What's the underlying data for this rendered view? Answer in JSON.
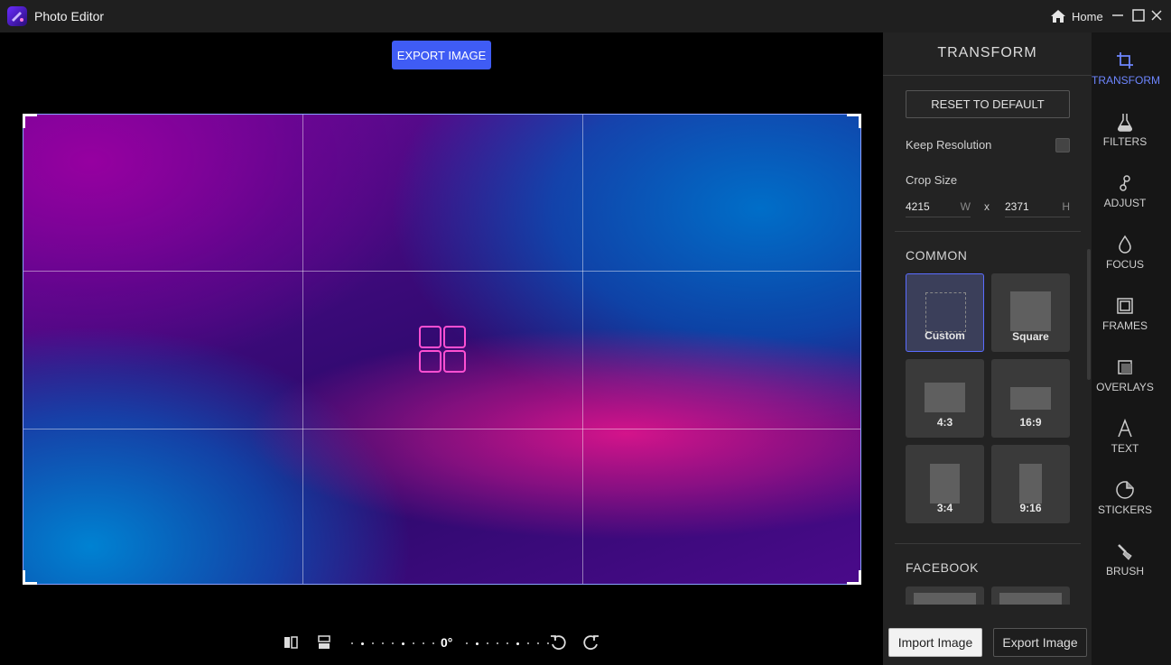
{
  "titlebar": {
    "app_title": "Photo Editor",
    "home_label": "Home"
  },
  "canvas": {
    "export_label": "EXPORT IMAGE",
    "rotation": "0°"
  },
  "panel": {
    "title": "TRANSFORM",
    "reset_label": "RESET TO DEFAULT",
    "keep_resolution_label": "Keep Resolution",
    "keep_resolution_checked": false,
    "crop_size_label": "Crop Size",
    "crop_w": "4215",
    "crop_w_unit": "W",
    "crop_x": "x",
    "crop_h": "2371",
    "crop_h_unit": "H",
    "common_title": "COMMON",
    "presets": [
      "Custom",
      "Square",
      "4:3",
      "16:9",
      "3:4",
      "9:16"
    ],
    "active_preset": "Custom",
    "facebook_title": "FACEBOOK",
    "import_label": "Import Image",
    "export_label": "Export Image"
  },
  "rail": {
    "items": [
      "TRANSFORM",
      "FILTERS",
      "ADJUST",
      "FOCUS",
      "FRAMES",
      "OVERLAYS",
      "TEXT",
      "STICKERS",
      "BRUSH"
    ],
    "active": "TRANSFORM",
    "active_color": "#6d86ff"
  },
  "colors": {
    "accent": "#3f5cf5",
    "center_icon": "#ff4fd2"
  }
}
